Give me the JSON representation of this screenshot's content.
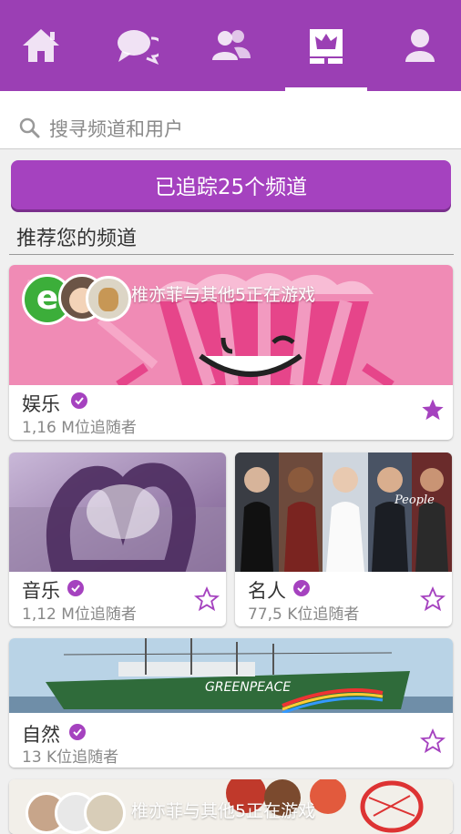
{
  "nav": {
    "tabs": [
      {
        "icon": "home-icon"
      },
      {
        "icon": "chat-icon"
      },
      {
        "icon": "friends-icon"
      },
      {
        "icon": "crown-channels-icon",
        "active": true
      },
      {
        "icon": "profile-icon"
      }
    ],
    "bg": "#9b3fb4"
  },
  "search": {
    "placeholder": "搜寻频道和用户"
  },
  "follow_button": {
    "label": "已追踪25个频道"
  },
  "section": {
    "title": "推荐您的频道"
  },
  "cards": [
    {
      "name": "娱乐",
      "followers": "1,16 M位追随者",
      "playing": "椎亦菲与其他5正在游戏",
      "starred": true
    },
    {
      "name": "音乐",
      "followers": "1,12 M位追随者",
      "starred": false
    },
    {
      "name": "名人",
      "followers": "77,5 K位追随者",
      "starred": false
    },
    {
      "name": "自然",
      "followers": "13 K位追随者",
      "starred": false
    },
    {
      "playing": "椎亦菲与其他5正在游戏"
    }
  ],
  "logo_letter": "e",
  "accent": "#a542bf"
}
